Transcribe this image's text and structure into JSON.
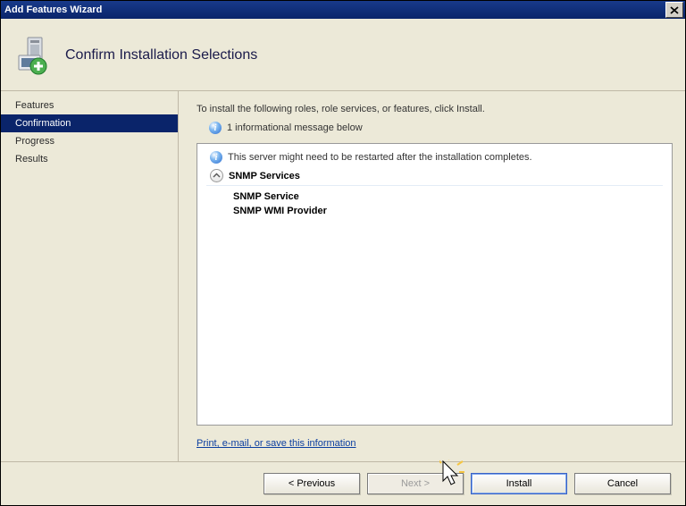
{
  "title": "Add Features Wizard",
  "header": {
    "heading": "Confirm Installation Selections"
  },
  "sidebar": {
    "items": [
      {
        "label": "Features"
      },
      {
        "label": "Confirmation",
        "selected": true
      },
      {
        "label": "Progress"
      },
      {
        "label": "Results"
      }
    ]
  },
  "main": {
    "instruction": "To install the following roles, role services, or features, click Install.",
    "info_summary": "1 informational message below",
    "restart_note": "This server might need to be restarted after the installation completes.",
    "group_title": "SNMP Services",
    "children": [
      "SNMP Service",
      "SNMP WMI Provider"
    ],
    "link_text": "Print, e-mail, or save this information"
  },
  "footer": {
    "previous": "< Previous",
    "next": "Next >",
    "install": "Install",
    "cancel": "Cancel"
  }
}
